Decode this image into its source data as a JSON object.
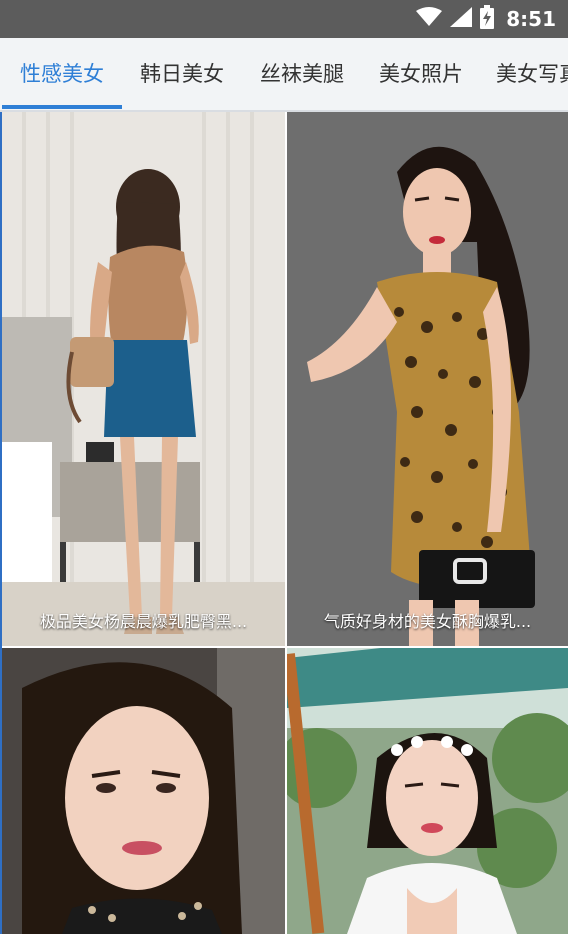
{
  "status_bar": {
    "time": "8:51",
    "icons": [
      "wifi-icon",
      "signal-icon",
      "battery-charging-icon"
    ],
    "background": "#5c5c5c"
  },
  "tabs": [
    {
      "label": "性感美女",
      "active": true
    },
    {
      "label": "韩日美女",
      "active": false
    },
    {
      "label": "丝袜美腿",
      "active": false
    },
    {
      "label": "美女照片",
      "active": false
    },
    {
      "label": "美女写真",
      "active": false
    }
  ],
  "accent_color": "#2f7fd6",
  "grid": {
    "cards": [
      {
        "caption": "极品美女杨晨晨爆乳肥臀黑..."
      },
      {
        "caption": "气质好身材的美女酥胸爆乳..."
      },
      {
        "caption": ""
      },
      {
        "caption": ""
      }
    ]
  }
}
